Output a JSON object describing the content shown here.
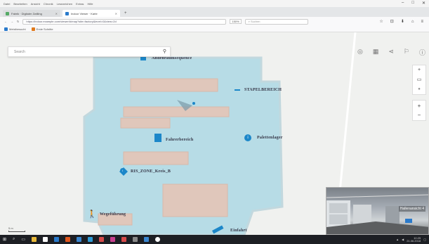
{
  "menu": {
    "items": [
      "Datei",
      "Bearbeiten",
      "Ansicht",
      "Chronik",
      "Lesezeichen",
      "Extras",
      "Hilfe"
    ],
    "window_controls": [
      "–",
      "□",
      "✕"
    ]
  },
  "tabs": [
    {
      "label": "Fabrik · Digitaler Zwilling",
      "active": false
    },
    {
      "label": "Indoor Viewer · Karte",
      "active": true
    }
  ],
  "navbar": {
    "url": "https://indoor.example.com/viewer/#/map?site=factory&level=0&view=2d",
    "zoom": "150%",
    "search_placeholder": "Suchen",
    "tool_icons": [
      "☆",
      "⊡",
      "⬇",
      "⌂",
      "≡"
    ]
  },
  "bookmarks": [
    {
      "label": "Meistbesucht"
    },
    {
      "label": "Erste Schritte"
    }
  ],
  "map": {
    "search_placeholder": "Search",
    "tools": [
      "◎",
      "▦",
      "⋖",
      "⚐",
      "ⓘ"
    ],
    "zoom_controls": [
      "+",
      "▭",
      "⚬"
    ],
    "zoom_controls2": [
      "+",
      "−"
    ],
    "scale_label": "5 m",
    "labels": [
      {
        "key": "a",
        "text": "Andenraumsequence"
      },
      {
        "key": "b",
        "text": "STAPELBEREICH"
      },
      {
        "key": "c",
        "text": "Palettenlager"
      },
      {
        "key": "d",
        "text": "Fahrerbereich"
      },
      {
        "key": "e",
        "text": "RIS_ZONE_Kreis_B"
      },
      {
        "key": "f",
        "text": "Wegeführung"
      },
      {
        "key": "g",
        "text": "Einfahrt"
      }
    ],
    "pins": [
      "i",
      "i"
    ],
    "pano_label": "Hallenansicht 4"
  },
  "taskbar": {
    "start": "⊞",
    "time": "10:25",
    "date": "21.06.2018"
  },
  "colors": {
    "floorplan": "#b7dce6",
    "shelf": "#e0c7bb",
    "pin": "#1c87c9"
  }
}
